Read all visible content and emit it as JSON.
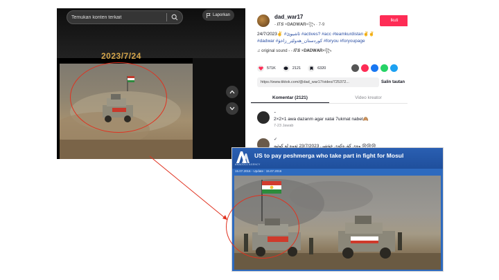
{
  "video": {
    "search_placeholder": "Temukan konten terkait",
    "report_label": "Laporkan",
    "date_overlay": "2023/7/24"
  },
  "post": {
    "username": "dad_war17",
    "subname": "- 𝑰𝑻𝑺 ×𝐃𝐀𝐃𝐖𝐀𝐑×꧂ · 7-9",
    "follow_label": "Ikuti",
    "caption_prefix": "24/7/2023✌️ ",
    "caption_tags_1": "#ئاشيوێ #actives? #acc #teamkurdistan✌️✌️",
    "caption_tags_2": "#dadwar #كوردستان_هەولێر_زاخۆ #foryou #foryoupage",
    "music": "♫ original sound - - 𝑰𝑻𝑺 ×𝐃𝐀𝐃𝐖𝐀𝐑×꧂",
    "likes": "571K",
    "comments": "2121",
    "saves": "6320",
    "link": "https://www.tiktok.com/@dad_war17/video/725372...",
    "copy_link_label": "Salin tautan"
  },
  "tabs": {
    "comments": "Komentar (2121)",
    "creator_videos": "Video kreator"
  },
  "comments": [
    {
      "name": "٠",
      "text": "2×2×1 awa dazanm agar xatai 7ukmat nabet🙈",
      "meta": "7-23      Jawab"
    },
    {
      "name": "✓",
      "text": "وەی کۆرەکەی خۆشی 23/7/2023 ئەوە لە کوێیە 😢😢😢",
      "meta": ""
    }
  ],
  "news": {
    "logo_sub": "ANADOLU AGENCY",
    "title": "US to pay peshmerga who take part in fight for Mosul",
    "date": "15.07.2016 - Update : 15.07.2016"
  },
  "colors": {
    "annotation_red": "#e0311f",
    "tiktok_red": "#fe2c55",
    "news_blue": "#2d6abf"
  }
}
